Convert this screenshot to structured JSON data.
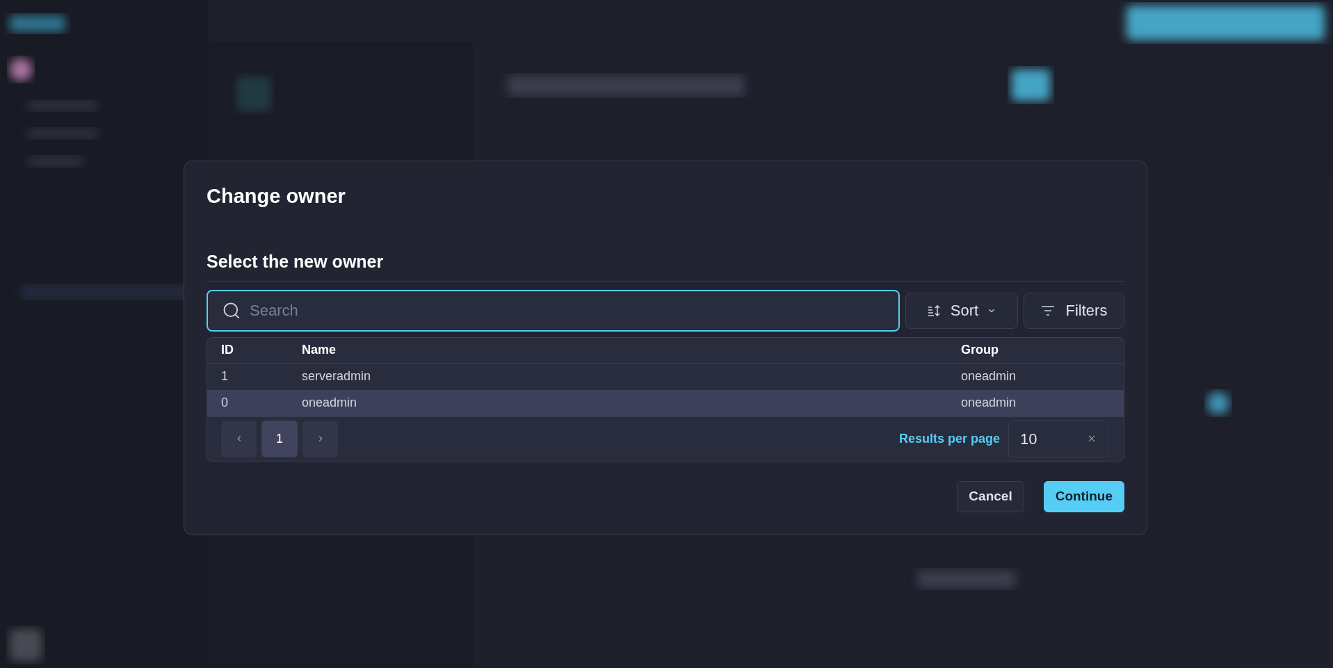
{
  "dialog": {
    "title": "Change owner",
    "section_title": "Select the new owner",
    "search": {
      "placeholder": "Search",
      "focused": true
    },
    "sort_button": "Sort",
    "filters_button": "Filters",
    "table": {
      "columns": [
        "ID",
        "Name",
        "Group"
      ],
      "rows": [
        {
          "cells": [
            "1",
            "serveradmin",
            "oneadmin"
          ],
          "selected": false
        },
        {
          "cells": [
            "0",
            "oneadmin",
            "oneadmin"
          ],
          "selected": true
        }
      ]
    },
    "pagination": {
      "pages": [
        {
          "label": "1",
          "selected": true
        }
      ],
      "results_label": "Results per page",
      "results_value": "10"
    },
    "buttons": [
      {
        "label": "Cancel",
        "kind": "secondary"
      },
      {
        "label": "Continue",
        "kind": "primary"
      }
    ]
  }
}
